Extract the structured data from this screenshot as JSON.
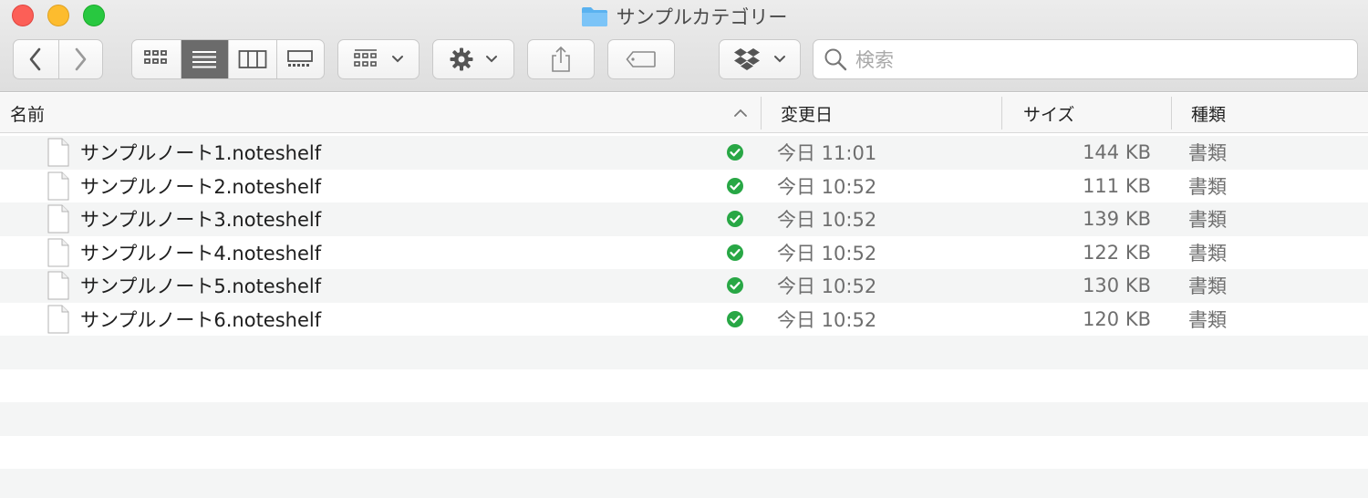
{
  "window": {
    "title": "サンプルカテゴリー"
  },
  "toolbar": {
    "nav": [
      "back",
      "forward"
    ],
    "view_modes": [
      "icon-view",
      "list-view",
      "column-view",
      "gallery-view"
    ],
    "active_view": "list-view",
    "search_placeholder": "検索"
  },
  "columns": {
    "name": "名前",
    "date": "変更日",
    "size": "サイズ",
    "kind": "種類"
  },
  "files": [
    {
      "name": "サンプルノート1.noteshelf",
      "date": "今日 11:01",
      "size": "144 KB",
      "kind": "書類",
      "status": "synced"
    },
    {
      "name": "サンプルノート2.noteshelf",
      "date": "今日 10:52",
      "size": "111 KB",
      "kind": "書類",
      "status": "synced"
    },
    {
      "name": "サンプルノート3.noteshelf",
      "date": "今日 10:52",
      "size": "139 KB",
      "kind": "書類",
      "status": "synced"
    },
    {
      "name": "サンプルノート4.noteshelf",
      "date": "今日 10:52",
      "size": "122 KB",
      "kind": "書類",
      "status": "synced"
    },
    {
      "name": "サンプルノート5.noteshelf",
      "date": "今日 10:52",
      "size": "130 KB",
      "kind": "書類",
      "status": "synced"
    },
    {
      "name": "サンプルノート6.noteshelf",
      "date": "今日 10:52",
      "size": "120 KB",
      "kind": "書類",
      "status": "synced"
    }
  ],
  "colors": {
    "synced": "#28a745",
    "folder": "#5ab2f0",
    "active_view": "#6b6b6b"
  }
}
